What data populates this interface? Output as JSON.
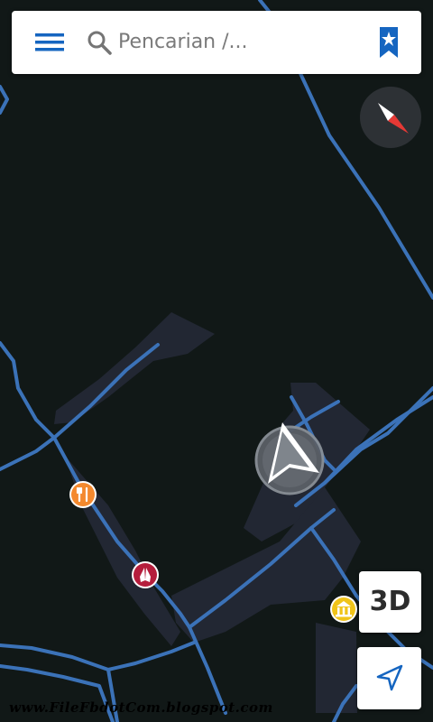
{
  "search": {
    "placeholder": "Pencarian /..."
  },
  "icons": {
    "menu": "hamburger-menu-icon",
    "search": "search-icon",
    "bookmark": "bookmark-star-icon",
    "compass": "compass-icon",
    "locate": "navigation-arrow-icon",
    "restaurant": "fork-knife-icon",
    "religious": "praying-hands-icon",
    "government": "government-building-icon",
    "position": "current-position-arrow-icon"
  },
  "buttons": {
    "view_3d_label": "3D"
  },
  "watermark": "www.FileFbdotCom.blogspot.com",
  "colors": {
    "accent": "#1565c0",
    "map_background": "#111817",
    "road": "#3b72b8",
    "area": "#222733",
    "restaurant_poi": "#f4892e",
    "religious_poi": "#b51d3c",
    "government_poi": "#f0c419"
  }
}
